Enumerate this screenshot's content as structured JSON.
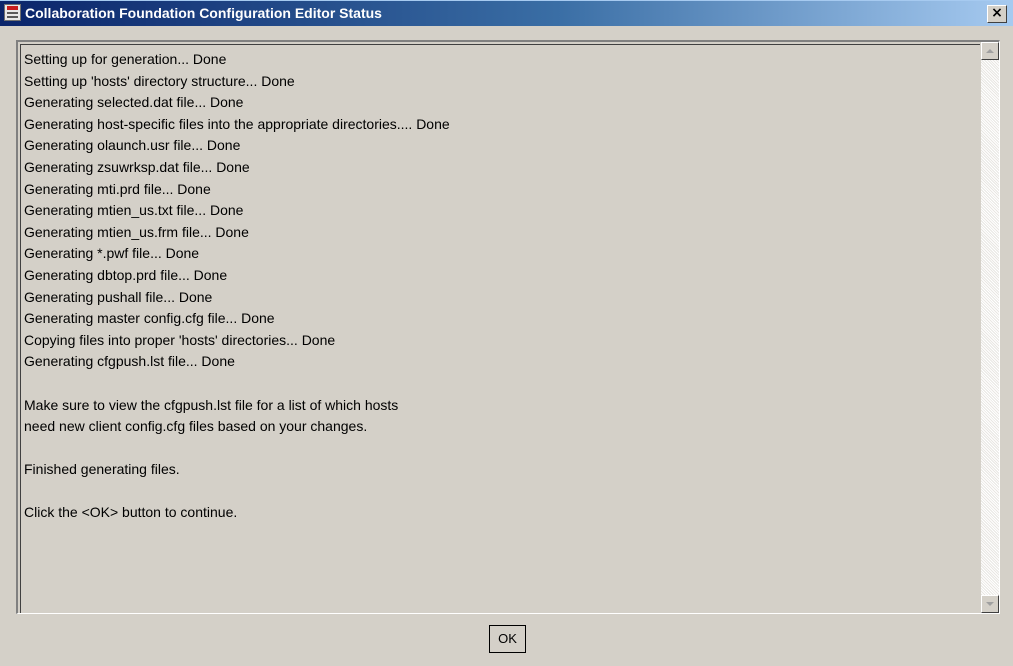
{
  "window": {
    "title": "Collaboration Foundation Configuration Editor Status",
    "icon": "app-icon",
    "close_glyph": "×",
    "close_icon": "close-icon"
  },
  "status_text": {
    "lines": [
      "Setting up for generation... Done",
      "Setting up 'hosts' directory structure... Done",
      "Generating selected.dat file... Done",
      "Generating host-specific files into the appropriate directories.... Done",
      "Generating olaunch.usr file... Done",
      "Generating zsuwrksp.dat file... Done",
      "Generating mti.prd file... Done",
      "Generating mtien_us.txt file... Done",
      "Generating mtien_us.frm file... Done",
      "Generating *.pwf file... Done",
      "Generating dbtop.prd file... Done",
      "Generating pushall file... Done",
      "Generating master config.cfg file... Done",
      "Copying files into proper 'hosts' directories... Done",
      "Generating cfgpush.lst file... Done",
      "",
      "Make sure to view the cfgpush.lst file for a list of which hosts",
      "need new client config.cfg files based on your changes.",
      "",
      "Finished generating files.",
      "",
      "Click the <OK> button to continue."
    ]
  },
  "scrollbar": {
    "up_icon": "scroll-up-arrow-icon",
    "down_icon": "scroll-down-arrow-icon"
  },
  "buttons": {
    "ok_label": "OK"
  },
  "colors": {
    "title_bar_start": "#0a246a",
    "title_bar_end": "#a6caf0",
    "window_background": "#d4d0c8"
  }
}
